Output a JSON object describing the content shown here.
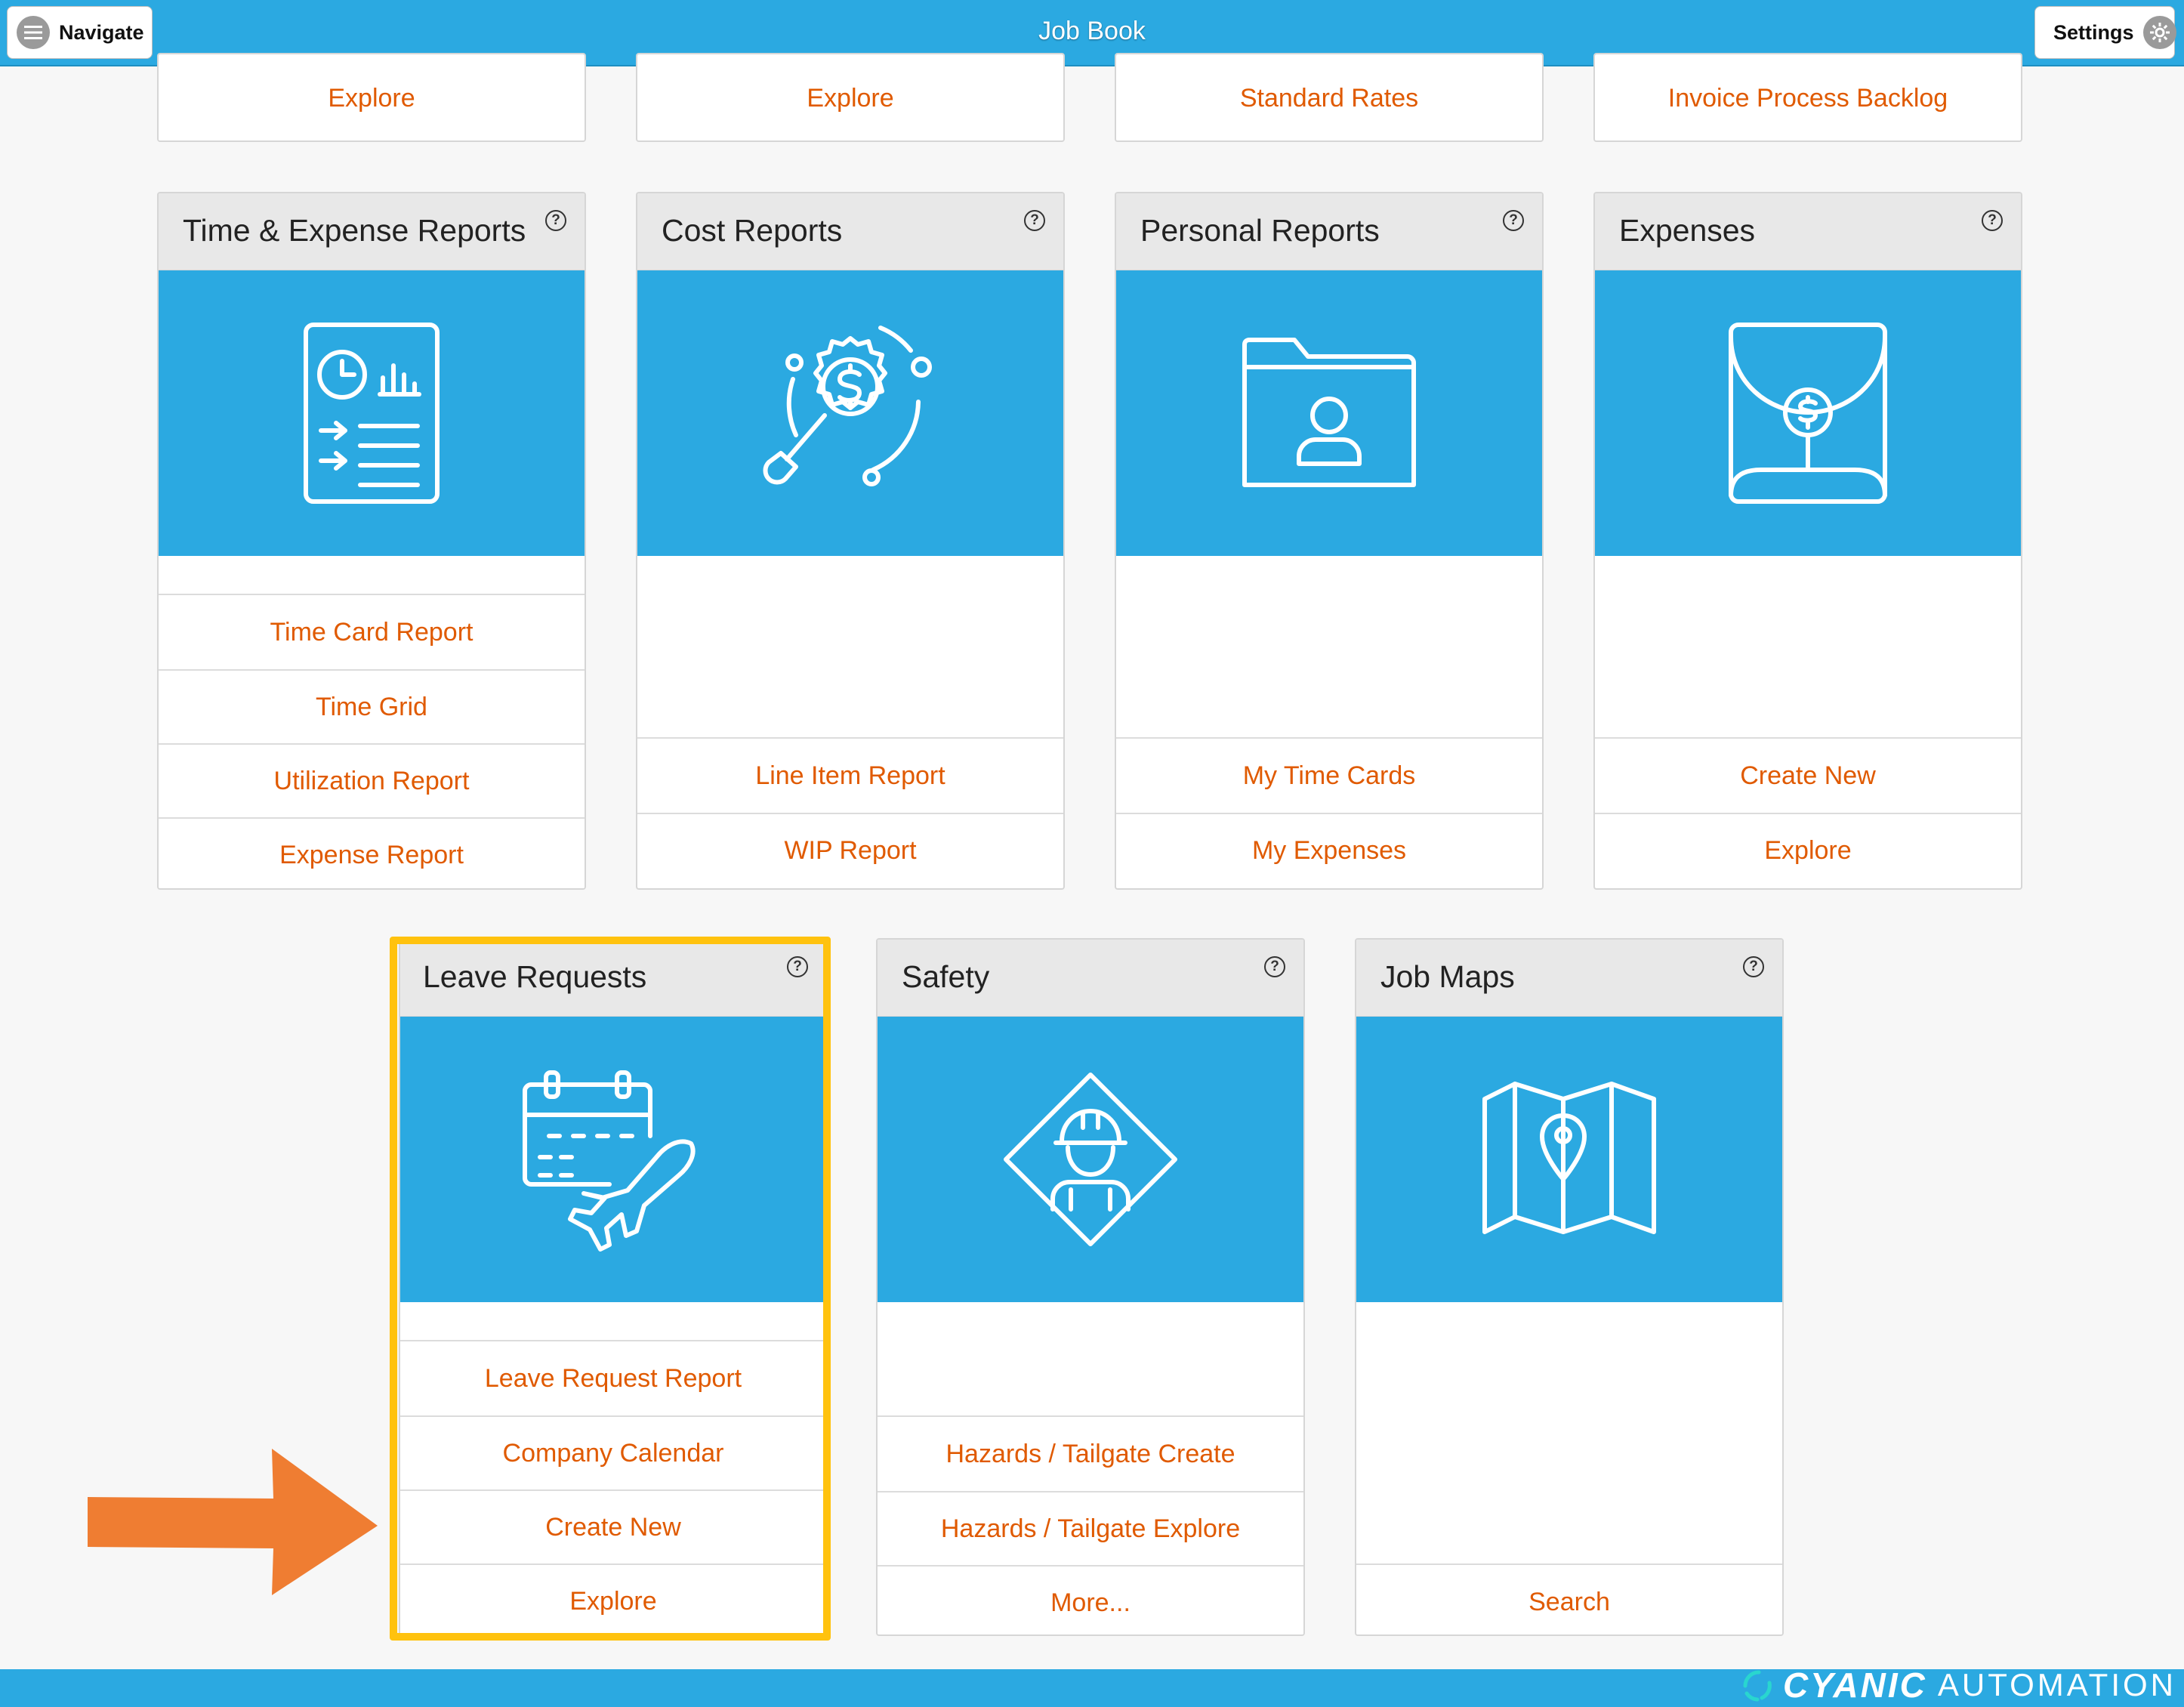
{
  "header": {
    "title": "Job Book",
    "navigate_label": "Navigate",
    "settings_label": "Settings"
  },
  "top_row_links": [
    "Explore",
    "Explore",
    "Standard Rates",
    "Invoice Process Backlog"
  ],
  "cards": [
    {
      "title": "Time & Expense Reports",
      "icon": "time-report-icon",
      "links": [
        "Time Card Report",
        "Time Grid",
        "Utilization Report",
        "Expense Report"
      ]
    },
    {
      "title": "Cost Reports",
      "icon": "cost-analysis-icon",
      "links": [
        "Line Item Report",
        "WIP Report"
      ]
    },
    {
      "title": "Personal Reports",
      "icon": "personal-folder-icon",
      "links": [
        "My Time Cards",
        "My Expenses"
      ]
    },
    {
      "title": "Expenses",
      "icon": "expense-envelope-icon",
      "links": [
        "Create New",
        "Explore"
      ]
    },
    {
      "title": "Leave Requests",
      "icon": "calendar-plane-icon",
      "links": [
        "Leave Request Report",
        "Company Calendar",
        "Create New",
        "Explore"
      ]
    },
    {
      "title": "Safety",
      "icon": "safety-worker-icon",
      "links": [
        "Hazards / Tailgate Create",
        "Hazards / Tailgate Explore",
        "More..."
      ]
    },
    {
      "title": "Job Maps",
      "icon": "map-pin-icon",
      "links": [
        "Search"
      ]
    }
  ],
  "help_glyph": "?",
  "footer": {
    "brand_strong": "CYANIC",
    "brand_light": "AUTOMATION"
  },
  "colors": {
    "accent": "#2ba9e1",
    "link": "#e05a00",
    "highlight": "#ffc20e",
    "arrow": "#ef7d32"
  }
}
